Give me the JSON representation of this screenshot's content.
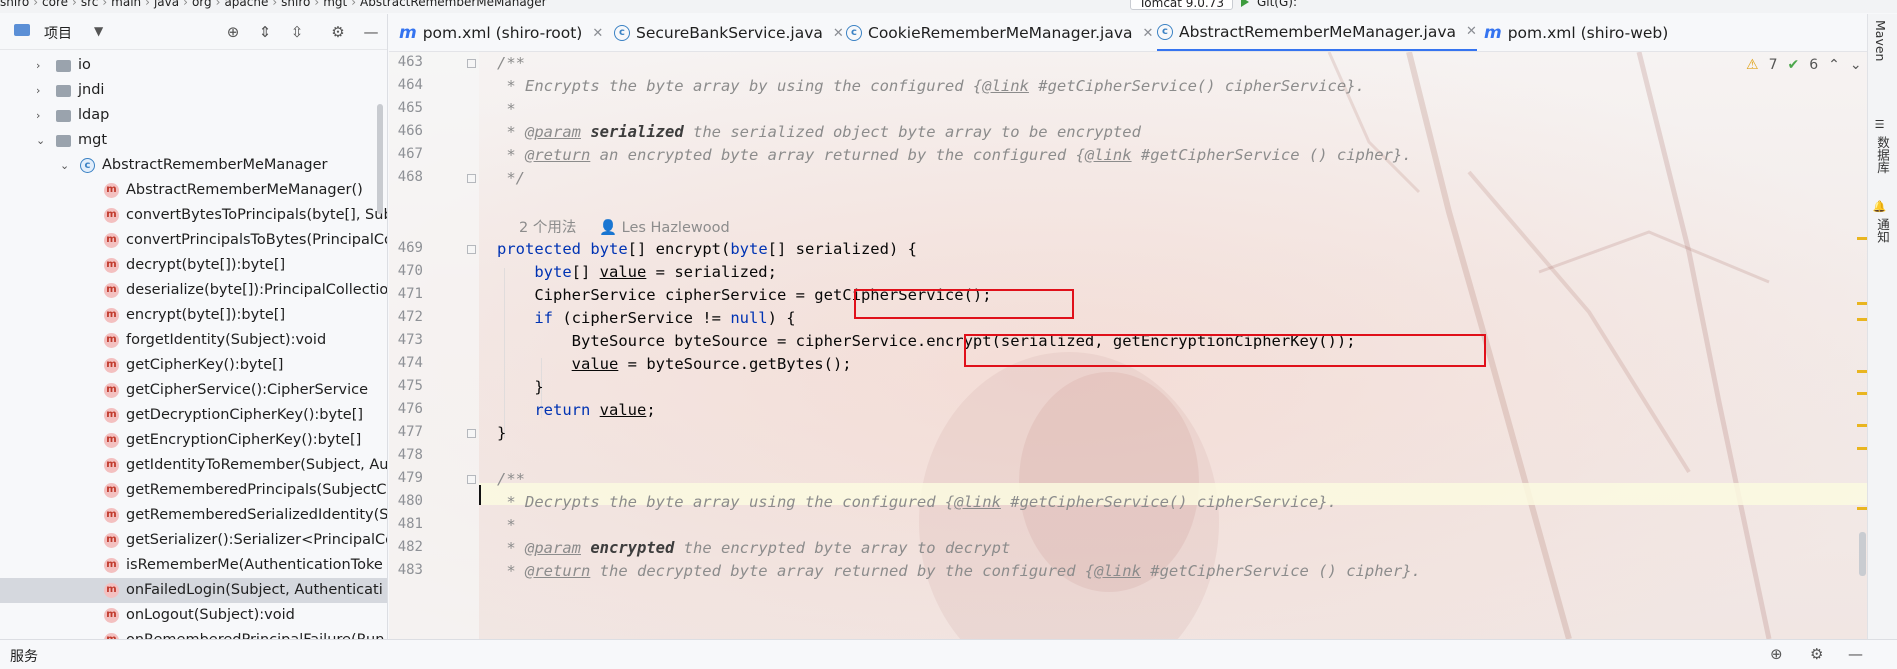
{
  "topbar": {
    "breadcrumbs": [
      "shiro",
      "core",
      "src",
      "main",
      "java",
      "org",
      "apache",
      "shiro",
      "mgt",
      "AbstractRememberMeManager"
    ],
    "run_config": "Tomcat 9.0.73",
    "git_label": "Git(G):"
  },
  "project": {
    "title": "项目",
    "tree": [
      {
        "label": "io",
        "kind": "package",
        "level": 1
      },
      {
        "label": "jndi",
        "kind": "package",
        "level": 1
      },
      {
        "label": "ldap",
        "kind": "package",
        "level": 1
      },
      {
        "label": "mgt",
        "kind": "package",
        "level": 1,
        "expanded": true
      },
      {
        "label": "AbstractRememberMeManager",
        "kind": "class",
        "level": 2,
        "expanded": true
      },
      {
        "label": "AbstractRememberMeManager()",
        "kind": "method",
        "level": 3
      },
      {
        "label": "convertBytesToPrincipals(byte[], Sub",
        "kind": "method",
        "level": 3
      },
      {
        "label": "convertPrincipalsToBytes(PrincipalCo",
        "kind": "method",
        "level": 3
      },
      {
        "label": "decrypt(byte[]):byte[]",
        "kind": "method",
        "level": 3
      },
      {
        "label": "deserialize(byte[]):PrincipalCollectio",
        "kind": "method",
        "level": 3
      },
      {
        "label": "encrypt(byte[]):byte[]",
        "kind": "method",
        "level": 3
      },
      {
        "label": "forgetIdentity(Subject):void",
        "kind": "method",
        "level": 3
      },
      {
        "label": "getCipherKey():byte[]",
        "kind": "method",
        "level": 3
      },
      {
        "label": "getCipherService():CipherService",
        "kind": "method",
        "level": 3
      },
      {
        "label": "getDecryptionCipherKey():byte[]",
        "kind": "method",
        "level": 3
      },
      {
        "label": "getEncryptionCipherKey():byte[]",
        "kind": "method",
        "level": 3
      },
      {
        "label": "getIdentityToRemember(Subject, Au",
        "kind": "method",
        "level": 3
      },
      {
        "label": "getRememberedPrincipals(SubjectC",
        "kind": "method",
        "level": 3
      },
      {
        "label": "getRememberedSerializedIdentity(S",
        "kind": "method",
        "level": 3
      },
      {
        "label": "getSerializer():Serializer<PrincipalCo",
        "kind": "method",
        "level": 3
      },
      {
        "label": "isRememberMe(AuthenticationToke",
        "kind": "method",
        "level": 3
      },
      {
        "label": "onFailedLogin(Subject, Authenticati",
        "kind": "method",
        "level": 3,
        "selected": true
      },
      {
        "label": "onLogout(Subject):void",
        "kind": "method",
        "level": 3
      },
      {
        "label": "onRememberedPrincipalFailure(Run",
        "kind": "method",
        "level": 3
      }
    ]
  },
  "tabs": [
    {
      "label": "pom.xml (shiro-root)",
      "icon": "maven-icon",
      "active": false
    },
    {
      "label": "SecureBankService.java",
      "icon": "class-icon",
      "active": false
    },
    {
      "label": "CookieRememberMeManager.java",
      "icon": "class-icon",
      "active": false
    },
    {
      "label": "AbstractRememberMeManager.java",
      "icon": "class-icon",
      "active": true
    },
    {
      "label": "pom.xml (shiro-web)",
      "icon": "maven-icon",
      "active": false
    }
  ],
  "inspections": {
    "warnings": "7",
    "weak_warnings": "6",
    "warning_color": "#e0a31a"
  },
  "editor": {
    "line_numbers": [
      "463",
      "464",
      "465",
      "466",
      "467",
      "468",
      "469",
      "470",
      "471",
      "472",
      "473",
      "474",
      "475",
      "476",
      "477",
      "478",
      "479",
      "480",
      "481",
      "482",
      "483"
    ],
    "usage_hint": "2 个用法",
    "author_hint": "Les Hazlewood",
    "code": {
      "l463": "/**",
      "l464a": " * Encrypts the byte array by using the configured {",
      "l464b": "@link",
      "l464c": " #getCipherService() cipherService}.",
      "l465": " *",
      "l466a": " * ",
      "l466b": "@param",
      "l466c": " ",
      "l466d": "serialized",
      "l466e": " the serialized object byte array to be encrypted",
      "l467a": " * ",
      "l467b": "@return",
      "l467c": " an encrypted byte array returned by the configured {",
      "l467d": "@link",
      "l467e": " #getCipherService () cipher}.",
      "l468": " */",
      "l469a": "protected",
      "l469b": " ",
      "l469c": "byte",
      "l469d": "[] encrypt(",
      "l469e": "byte",
      "l469f": "[] serialized) {",
      "l470a": "    ",
      "l470b": "byte",
      "l470c": "[] ",
      "l470d": "value",
      "l470e": " = serialized;",
      "l471": "    CipherService cipherService = getCipherService();",
      "l472a": "    ",
      "l472b": "if",
      "l472c": " (cipherService != ",
      "l472d": "null",
      "l472e": ") {",
      "l473": "        ByteSource byteSource = cipherService.encrypt(serialized, getEncryptionCipherKey());",
      "l474a": "        ",
      "l474b": "value",
      "l474c": " = byteSource.getBytes();",
      "l475": "    }",
      "l476a": "    ",
      "l476b": "return",
      "l476c": " ",
      "l476d": "value",
      "l476e": ";",
      "l477": "}",
      "l479": "/**",
      "l480a": " * Decrypts the byte array using the configured {",
      "l480b": "@link",
      "l480c": " #getCipherService() cipherService}.",
      "l481": " *",
      "l482a": " * ",
      "l482b": "@param",
      "l482c": " ",
      "l482d": "encrypted",
      "l482e": " the encrypted byte array to decrypt",
      "l483a": " * ",
      "l483b": "@return",
      "l483c": " the decrypted byte array returned by the configured {",
      "l483d": "@link",
      "l483e": " #getCipherService () cipher}."
    }
  },
  "right_strip": {
    "maven": "Maven",
    "database": "数据库",
    "notifications": "通知"
  },
  "bottom": {
    "services": "服务"
  },
  "colors": {
    "accent": "#3574f0",
    "highlight_box": "#e0101a",
    "keyword": "#0033b3",
    "comment": "#8c8c8c"
  }
}
